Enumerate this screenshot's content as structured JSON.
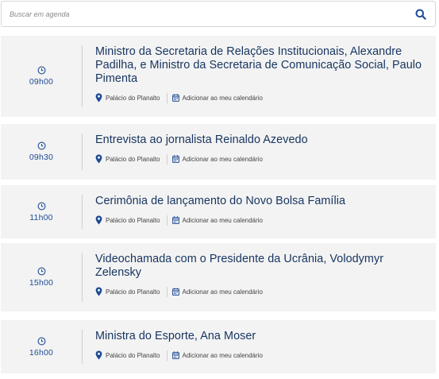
{
  "search": {
    "placeholder": "Buscar em agenda",
    "value": ""
  },
  "colors": {
    "title": "#16345f",
    "time": "#1e4b94",
    "card_bg": "#f3f3f3",
    "icon": "#1e4b94"
  },
  "events": [
    {
      "time": "09h00",
      "title": "Ministro da Secretaria de Relações Institucionais, Alexandre Padilha, e Ministro da Secretaria de Comunicação Social, Paulo Pimenta",
      "location": "Palácio do Planalto",
      "calendar_label": "Adicionar ao meu calendário"
    },
    {
      "time": "09h30",
      "title": "Entrevista ao jornalista Reinaldo Azevedo",
      "location": "Palácio do Planalto",
      "calendar_label": "Adicionar ao meu calendário"
    },
    {
      "time": "11h00",
      "title": "Cerimônia de lançamento do Novo Bolsa Família",
      "location": "Palácio do Planalto",
      "calendar_label": "Adicionar ao meu calendário"
    },
    {
      "time": "15h00",
      "title": "Videochamada com o Presidente da Ucrânia, Volodymyr Zelensky",
      "location": "Palácio do Planalto",
      "calendar_label": "Adicionar ao meu calendário"
    },
    {
      "time": "16h00",
      "title": "Ministra do Esporte, Ana Moser",
      "location": "Palácio do Planalto",
      "calendar_label": "Adicionar ao meu calendário"
    }
  ],
  "icons": {
    "search": "search-icon",
    "clock": "clock-icon",
    "location": "map-pin-icon",
    "calendar": "calendar-icon"
  }
}
